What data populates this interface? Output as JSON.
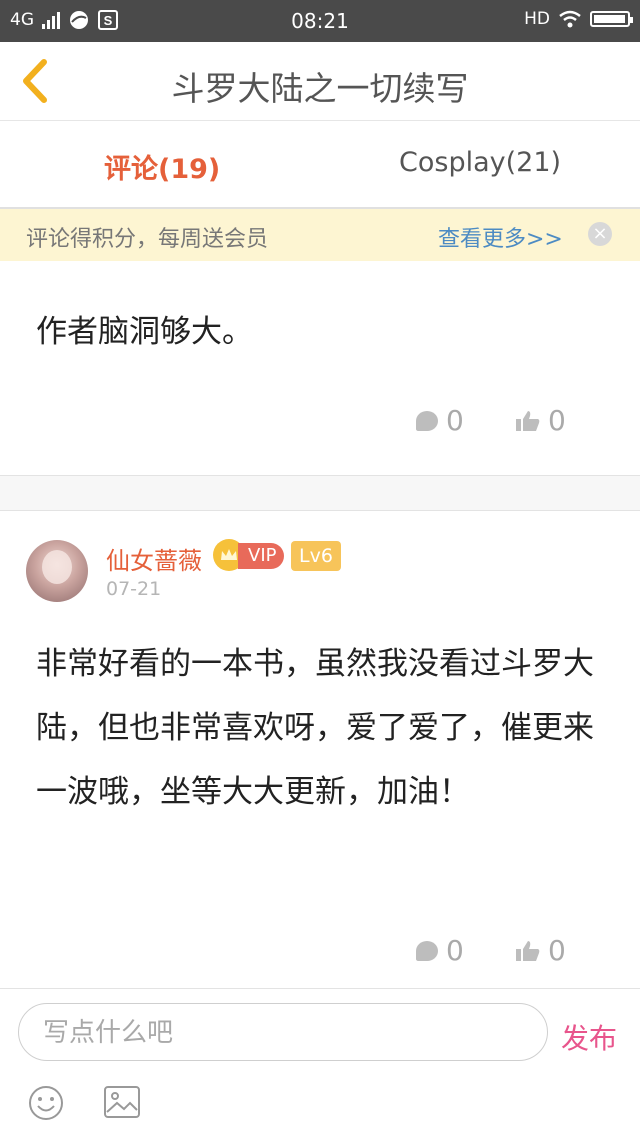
{
  "status_bar": {
    "network": "4G",
    "time": "08:21",
    "hd": "HD"
  },
  "header": {
    "title": "斗罗大陆之一切续写"
  },
  "tabs": [
    {
      "label": "评论(19)",
      "active": true
    },
    {
      "label": "Cosplay(21)",
      "active": false
    }
  ],
  "notice": {
    "text": "评论得积分，每周送会员",
    "link": "查看更多>>"
  },
  "comments": [
    {
      "text": "作者脑洞够大。",
      "reply_count": "0",
      "like_count": "0"
    },
    {
      "username": "仙女蔷薇",
      "vip_label": "VIP",
      "level": "Lv6",
      "date": "07-21",
      "text": "非常好看的一本书，虽然我没看过斗罗大陆，但也非常喜欢呀，爱了爱了，催更来一波哦，坐等大大更新，加油！",
      "reply_count": "0",
      "like_count": "0"
    }
  ],
  "composer": {
    "placeholder": "写点什么吧",
    "send_label": "发布"
  },
  "colors": {
    "accent": "#e5603a",
    "link": "#4d8bc3",
    "send": "#e8558c",
    "notice_bg": "#fdf5d2"
  }
}
